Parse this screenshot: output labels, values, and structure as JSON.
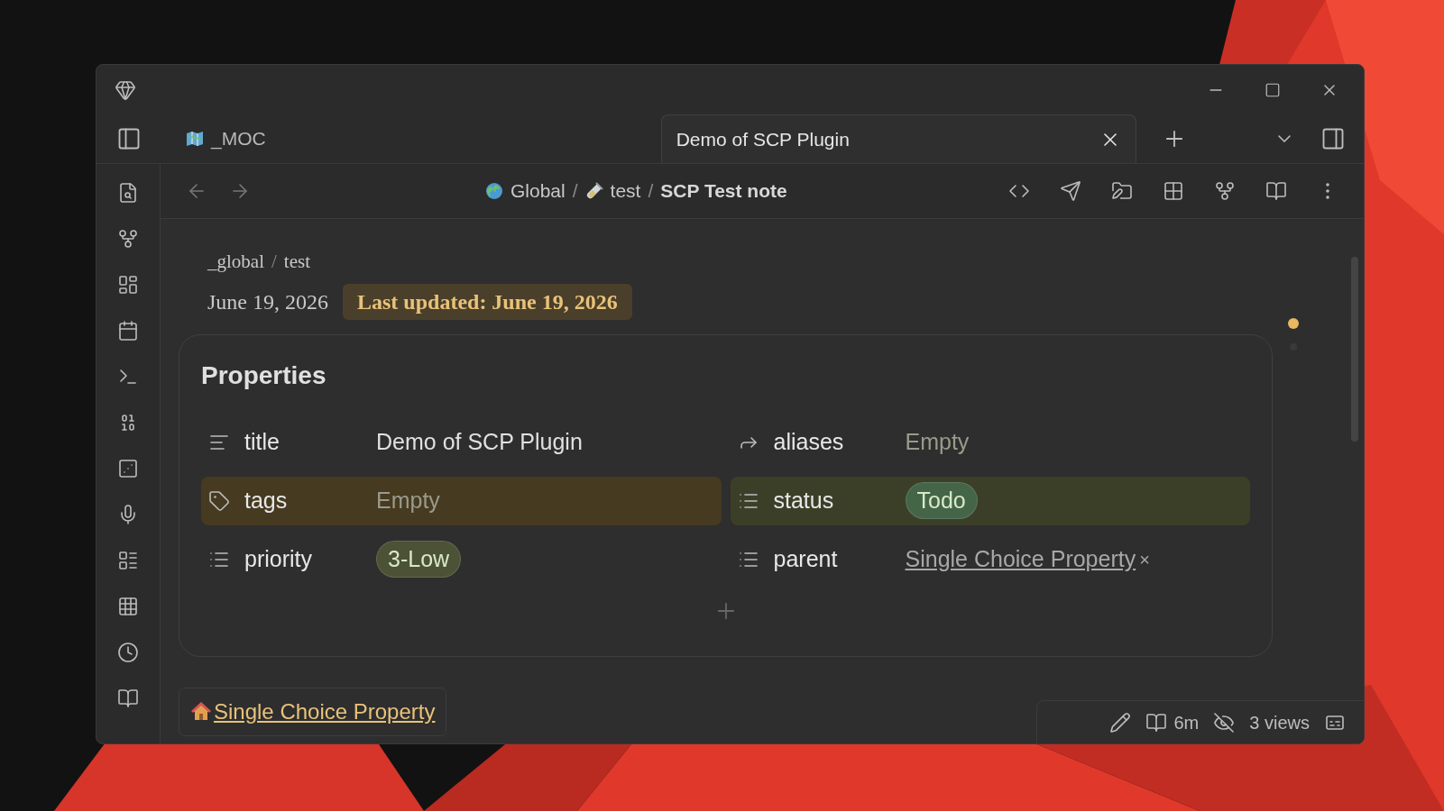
{
  "tabs": [
    {
      "label": "_MOC",
      "selected": false
    },
    {
      "label": "Demo of SCP Plugin",
      "selected": true
    }
  ],
  "breadcrumb": [
    {
      "kind": "crumb",
      "label": "Global"
    },
    {
      "kind": "separator",
      "label": "/"
    },
    {
      "kind": "crumb",
      "label": "test"
    },
    {
      "kind": "separator",
      "label": "/"
    },
    {
      "kind": "current",
      "label": "SCP Test note"
    }
  ],
  "note_path": [
    {
      "kind": "crumb",
      "label": "_global"
    },
    {
      "kind": "separator",
      "label": "/"
    },
    {
      "kind": "crumb",
      "label": "test"
    }
  ],
  "date": "June 19, 2026",
  "last_updated": "Last updated: June 19, 2026",
  "properties": {
    "title": "Properties",
    "rows": [
      {
        "kind": "text",
        "key": "title",
        "value": {
          "kind": "text",
          "text": "Demo of SCP Plugin"
        }
      },
      {
        "kind": "aliases",
        "key": "aliases",
        "value": {
          "kind": "empty",
          "text": "Empty"
        }
      },
      {
        "kind": "tags",
        "key": "tags",
        "color": "#463a20",
        "value": {
          "kind": "empty",
          "text": "Empty"
        }
      },
      {
        "kind": "list",
        "key": "status",
        "color": "#3c3f28",
        "value": {
          "kind": "pill",
          "text": "Todo",
          "color": "#446548"
        }
      },
      {
        "kind": "list",
        "key": "priority",
        "value": {
          "kind": "pill",
          "text": "3-Low",
          "color": "#4b5235"
        }
      },
      {
        "kind": "list",
        "key": "parent",
        "value": {
          "kind": "link",
          "text": "Single Choice Property",
          "remove": "×"
        }
      }
    ]
  },
  "footer_link": "Single Choice Property",
  "status_bar": {
    "reading_time": "6m",
    "views": "3 views"
  }
}
